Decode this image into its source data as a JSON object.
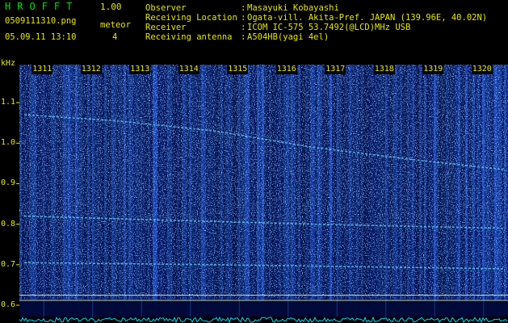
{
  "header": {
    "app_title": "HROFFT",
    "version": "1.00",
    "filename": "0509111310.png",
    "meteor_label": "meteor",
    "datetime": "05.09.11 13:10",
    "meteor_count": "4"
  },
  "info": [
    {
      "label": "Observer",
      "value": "Masayuki Kobayashi"
    },
    {
      "label": "Receiving Location",
      "value": "Ogata-vill. Akita-Pref. JAPAN (139.96E, 40.02N)"
    },
    {
      "label": "Receiver",
      "value": "ICOM IC-575 53.7492(@LCD)MHz USB"
    },
    {
      "label": "Receiving antenna",
      "value": "A504HB(yagi 4el)"
    }
  ],
  "colors": {
    "background": "#000000",
    "text_yellow": "#e6e600",
    "title_green": "#00e000",
    "spectrogram_bg": "#000a3a",
    "echo_cyan": "#6fdcff",
    "baseline_cyan": "#00d8ff"
  },
  "chart_data": {
    "type": "heatmap",
    "ylabel": "kHz",
    "ylim": [
      0.6,
      1.15
    ],
    "yticks": [
      0.6,
      0.7,
      0.8,
      0.9,
      1.0,
      1.1
    ],
    "ytick_labels": [
      "0.6",
      "0.7",
      "0.8",
      "0.9",
      "1.0",
      "1.1"
    ],
    "xlim": [
      1310.5,
      1320.5
    ],
    "time_labels": [
      "1311",
      "1312",
      "1313",
      "1314",
      "1315",
      "1316",
      "1317",
      "1318",
      "1319",
      "1320"
    ],
    "time_values": [
      1311,
      1312,
      1313,
      1314,
      1315,
      1316,
      1317,
      1318,
      1319,
      1320
    ],
    "reference_lines_khz": [
      0.612,
      0.625
    ],
    "series": [
      {
        "x": [
          1310.6,
          1312.5,
          1314.5,
          1316.5,
          1318.5,
          1320.4
        ],
        "y": [
          1.07,
          1.055,
          1.03,
          0.99,
          0.96,
          0.935
        ]
      },
      {
        "x": [
          1310.6,
          1313.5,
          1316.5,
          1320.4
        ],
        "y": [
          0.82,
          0.81,
          0.8,
          0.79
        ]
      },
      {
        "x": [
          1310.6,
          1314.5,
          1320.4
        ],
        "y": [
          0.705,
          0.7,
          0.69
        ]
      }
    ]
  }
}
